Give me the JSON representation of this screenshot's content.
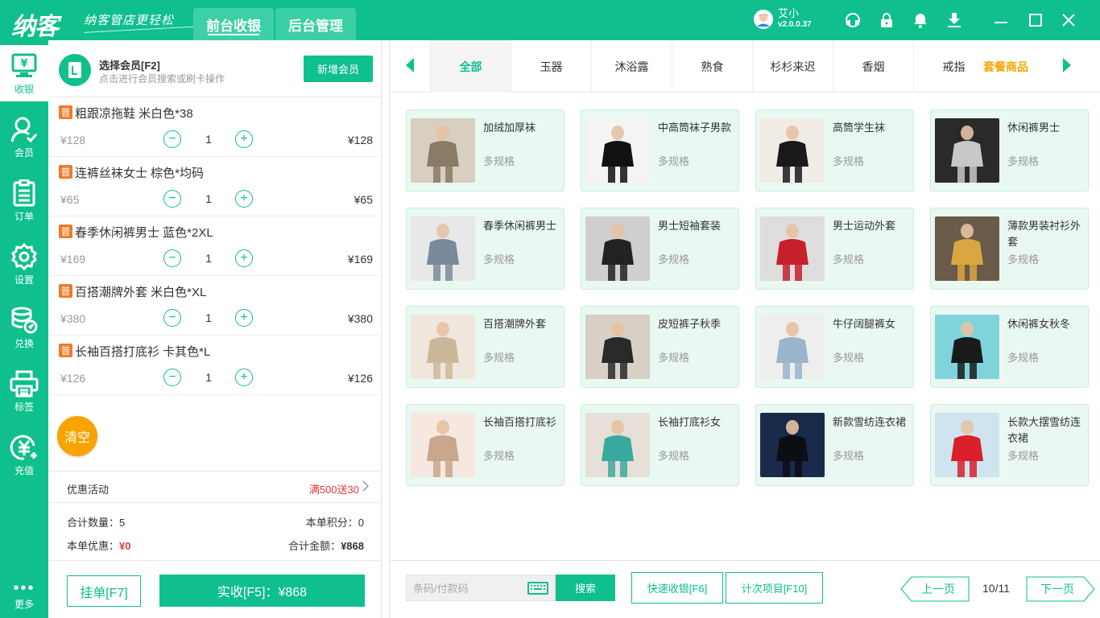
{
  "app": {
    "logo": "纳客",
    "slogan": "纳客管店更轻松",
    "tabs": [
      "前台收银",
      "后台管理"
    ],
    "user": {
      "name": "艾小",
      "version": "v2.0.0.37"
    },
    "top_icons": [
      "support-icon",
      "lock-icon",
      "bell-icon",
      "download-icon",
      "minimize-icon",
      "maximize-icon",
      "close-icon"
    ]
  },
  "sidebar": {
    "items": [
      {
        "label": "收银",
        "icon": "cashier-icon"
      },
      {
        "label": "会员",
        "icon": "member-icon"
      },
      {
        "label": "订单",
        "icon": "order-icon"
      },
      {
        "label": "设置",
        "icon": "settings-icon"
      },
      {
        "label": "兑换",
        "icon": "exchange-icon"
      },
      {
        "label": "标签",
        "icon": "printer-icon"
      },
      {
        "label": "充值",
        "icon": "recharge-icon"
      }
    ],
    "more": "更多"
  },
  "cart": {
    "member_title": "选择会员[F2]",
    "member_sub": "点击进行会员搜索或刷卡操作",
    "new_member": "新增会员",
    "items": [
      {
        "badge": "普",
        "name": "粗跟凉拖鞋 米白色*38",
        "price": "¥128",
        "qty": "1",
        "total": "¥128"
      },
      {
        "badge": "普",
        "name": "连裤丝袜女士 棕色*均码",
        "price": "¥65",
        "qty": "1",
        "total": "¥65"
      },
      {
        "badge": "普",
        "name": "春季休闲裤男士 蓝色*2XL",
        "price": "¥169",
        "qty": "1",
        "total": "¥169"
      },
      {
        "badge": "普",
        "name": "百搭潮牌外套 米白色*XL",
        "price": "¥380",
        "qty": "1",
        "total": "¥380"
      },
      {
        "badge": "普",
        "name": "长袖百搭打底衫 卡其色*L",
        "price": "¥126",
        "qty": "1",
        "total": "¥126"
      }
    ],
    "clear": "清空",
    "promo_label": "优惠活动",
    "promo_value": "满500送30",
    "total_qty_label": "合计数量：",
    "total_qty": "5",
    "points_label": "本单积分：",
    "points": "0",
    "discount_label": "本单优惠：",
    "discount": "¥0",
    "total_amount_label": "合计金额：",
    "total_amount": "¥868",
    "hang": "挂单[F7]",
    "pay": "实收[F5]：¥868"
  },
  "categories": [
    "全部",
    "玉器",
    "沐浴露",
    "熟食",
    "杉杉来迟",
    "香烟",
    "戒指",
    "套餐商品"
  ],
  "products": [
    {
      "name": "加绒加厚袜",
      "spec": "多规格",
      "colors": [
        "#d8cfc0",
        "#8a7a66"
      ]
    },
    {
      "name": "中高筒袜子男款",
      "spec": "多规格",
      "colors": [
        "#f4f4f4",
        "#111111"
      ]
    },
    {
      "name": "高筒学生袜",
      "spec": "多规格",
      "colors": [
        "#f1ece6",
        "#1a1a1a"
      ]
    },
    {
      "name": "休闲裤男士",
      "spec": "多规格",
      "colors": [
        "#2a2a2a",
        "#c8c8c8"
      ]
    },
    {
      "name": "春季休闲裤男士",
      "spec": "多规格",
      "colors": [
        "#e8e8e8",
        "#7a8a9a"
      ]
    },
    {
      "name": "男士短袖套装",
      "spec": "多规格",
      "colors": [
        "#cfcfcf",
        "#222222"
      ]
    },
    {
      "name": "男士运动外套",
      "spec": "多规格",
      "colors": [
        "#dddddd",
        "#c8202a"
      ]
    },
    {
      "name": "薄款男装衬衫外套",
      "spec": "多规格",
      "colors": [
        "#6a5a4a",
        "#d9a640"
      ]
    },
    {
      "name": "百搭潮牌外套",
      "spec": "多规格",
      "colors": [
        "#efe7dc",
        "#cbb89a"
      ]
    },
    {
      "name": "皮短裤子秋季",
      "spec": "多规格",
      "colors": [
        "#d8d0c4",
        "#2a2a2a"
      ]
    },
    {
      "name": "牛仔阔腿裤女",
      "spec": "多规格",
      "colors": [
        "#eeeeee",
        "#9ab4cc"
      ]
    },
    {
      "name": "休闲裤女秋冬",
      "spec": "多规格",
      "colors": [
        "#7fd4dc",
        "#1a1a1a"
      ]
    },
    {
      "name": "长袖百搭打底衫",
      "spec": "多规格",
      "colors": [
        "#f6e8e0",
        "#c9a68c"
      ]
    },
    {
      "name": "长袖打底衫女",
      "spec": "多规格",
      "colors": [
        "#e6e0d8",
        "#3aa9a0"
      ]
    },
    {
      "name": "新款雪纺连衣裙",
      "spec": "多规格",
      "colors": [
        "#1a2a4a",
        "#0d0d14"
      ]
    },
    {
      "name": "长款大摆雪纺连衣裙",
      "spec": "多规格",
      "colors": [
        "#cfe4ef",
        "#d81f2a"
      ]
    }
  ],
  "footer": {
    "scan_placeholder": "条码/付款码",
    "search": "搜索",
    "quick_pay": "快速收银[F6]",
    "count_item": "计次项目[F10]",
    "prev": "上一页",
    "page": "10/11",
    "next": "下一页"
  },
  "colors": {
    "brand": "#0fbf8c",
    "accent_orange": "#f7a400",
    "badge_orange": "#f07a2a",
    "red": "#e4393c",
    "card_bg": "#e9f8f1"
  }
}
